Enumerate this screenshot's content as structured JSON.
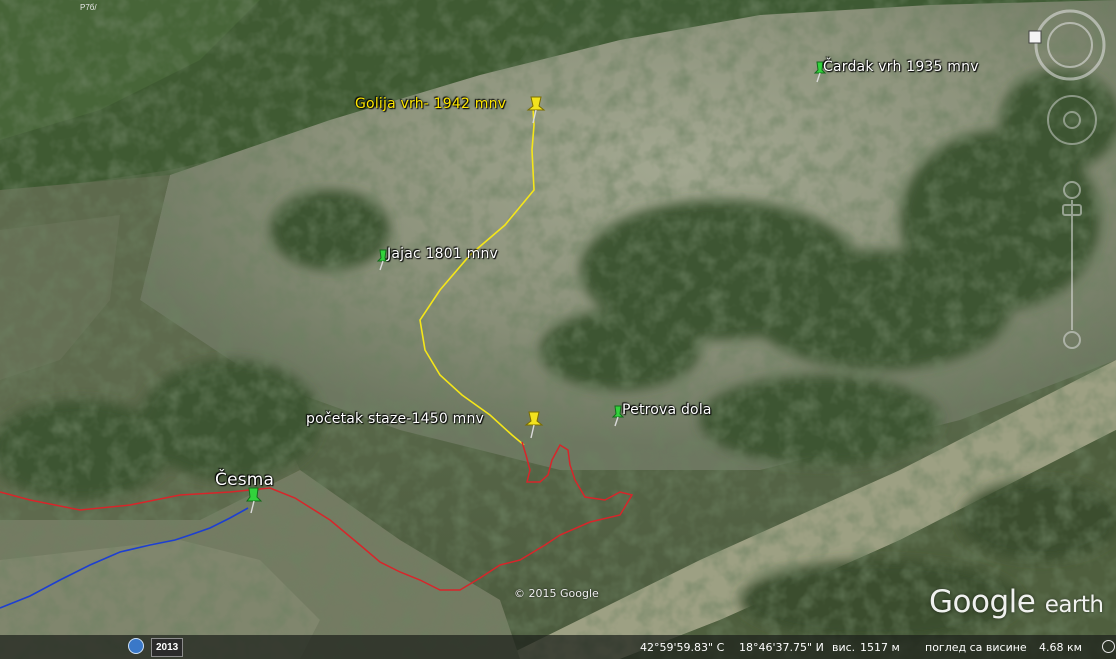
{
  "placemarks": {
    "cardak": "Čardak vrh 1935 mnv",
    "golija": "Golija vrh- 1942 mnv",
    "jajac": "Jajac 1801 mnv",
    "pocetak": "početak staze-1450 mnv",
    "petrova": "Petrova dola",
    "cesma": "Česma"
  },
  "top_road_label": "P7б/",
  "copyright": "© 2015 Google",
  "logo": {
    "google": "Google",
    "earth": "earth"
  },
  "status": {
    "year": "2013",
    "lat": "42°59'59.83\" С",
    "lon": "18°46'37.75\" И",
    "elev_label": "вис.",
    "elev_value": "1517 м",
    "eye_label": "поглед са висине",
    "eye_value": "4.68 км"
  },
  "colors": {
    "yellow_pin": "#f2e21e",
    "green_pin": "#32d23c",
    "hike_path": "#f5e619",
    "red_route": "#d8252a",
    "blue_route": "#1d3fd1"
  },
  "icons": {
    "compass": "compass-icon",
    "look_joystick": "look-joystick-icon",
    "move_joystick": "move-joystick-icon",
    "zoom_slider": "zoom-slider-icon",
    "historical_imagery": "historical-imagery-icon"
  }
}
